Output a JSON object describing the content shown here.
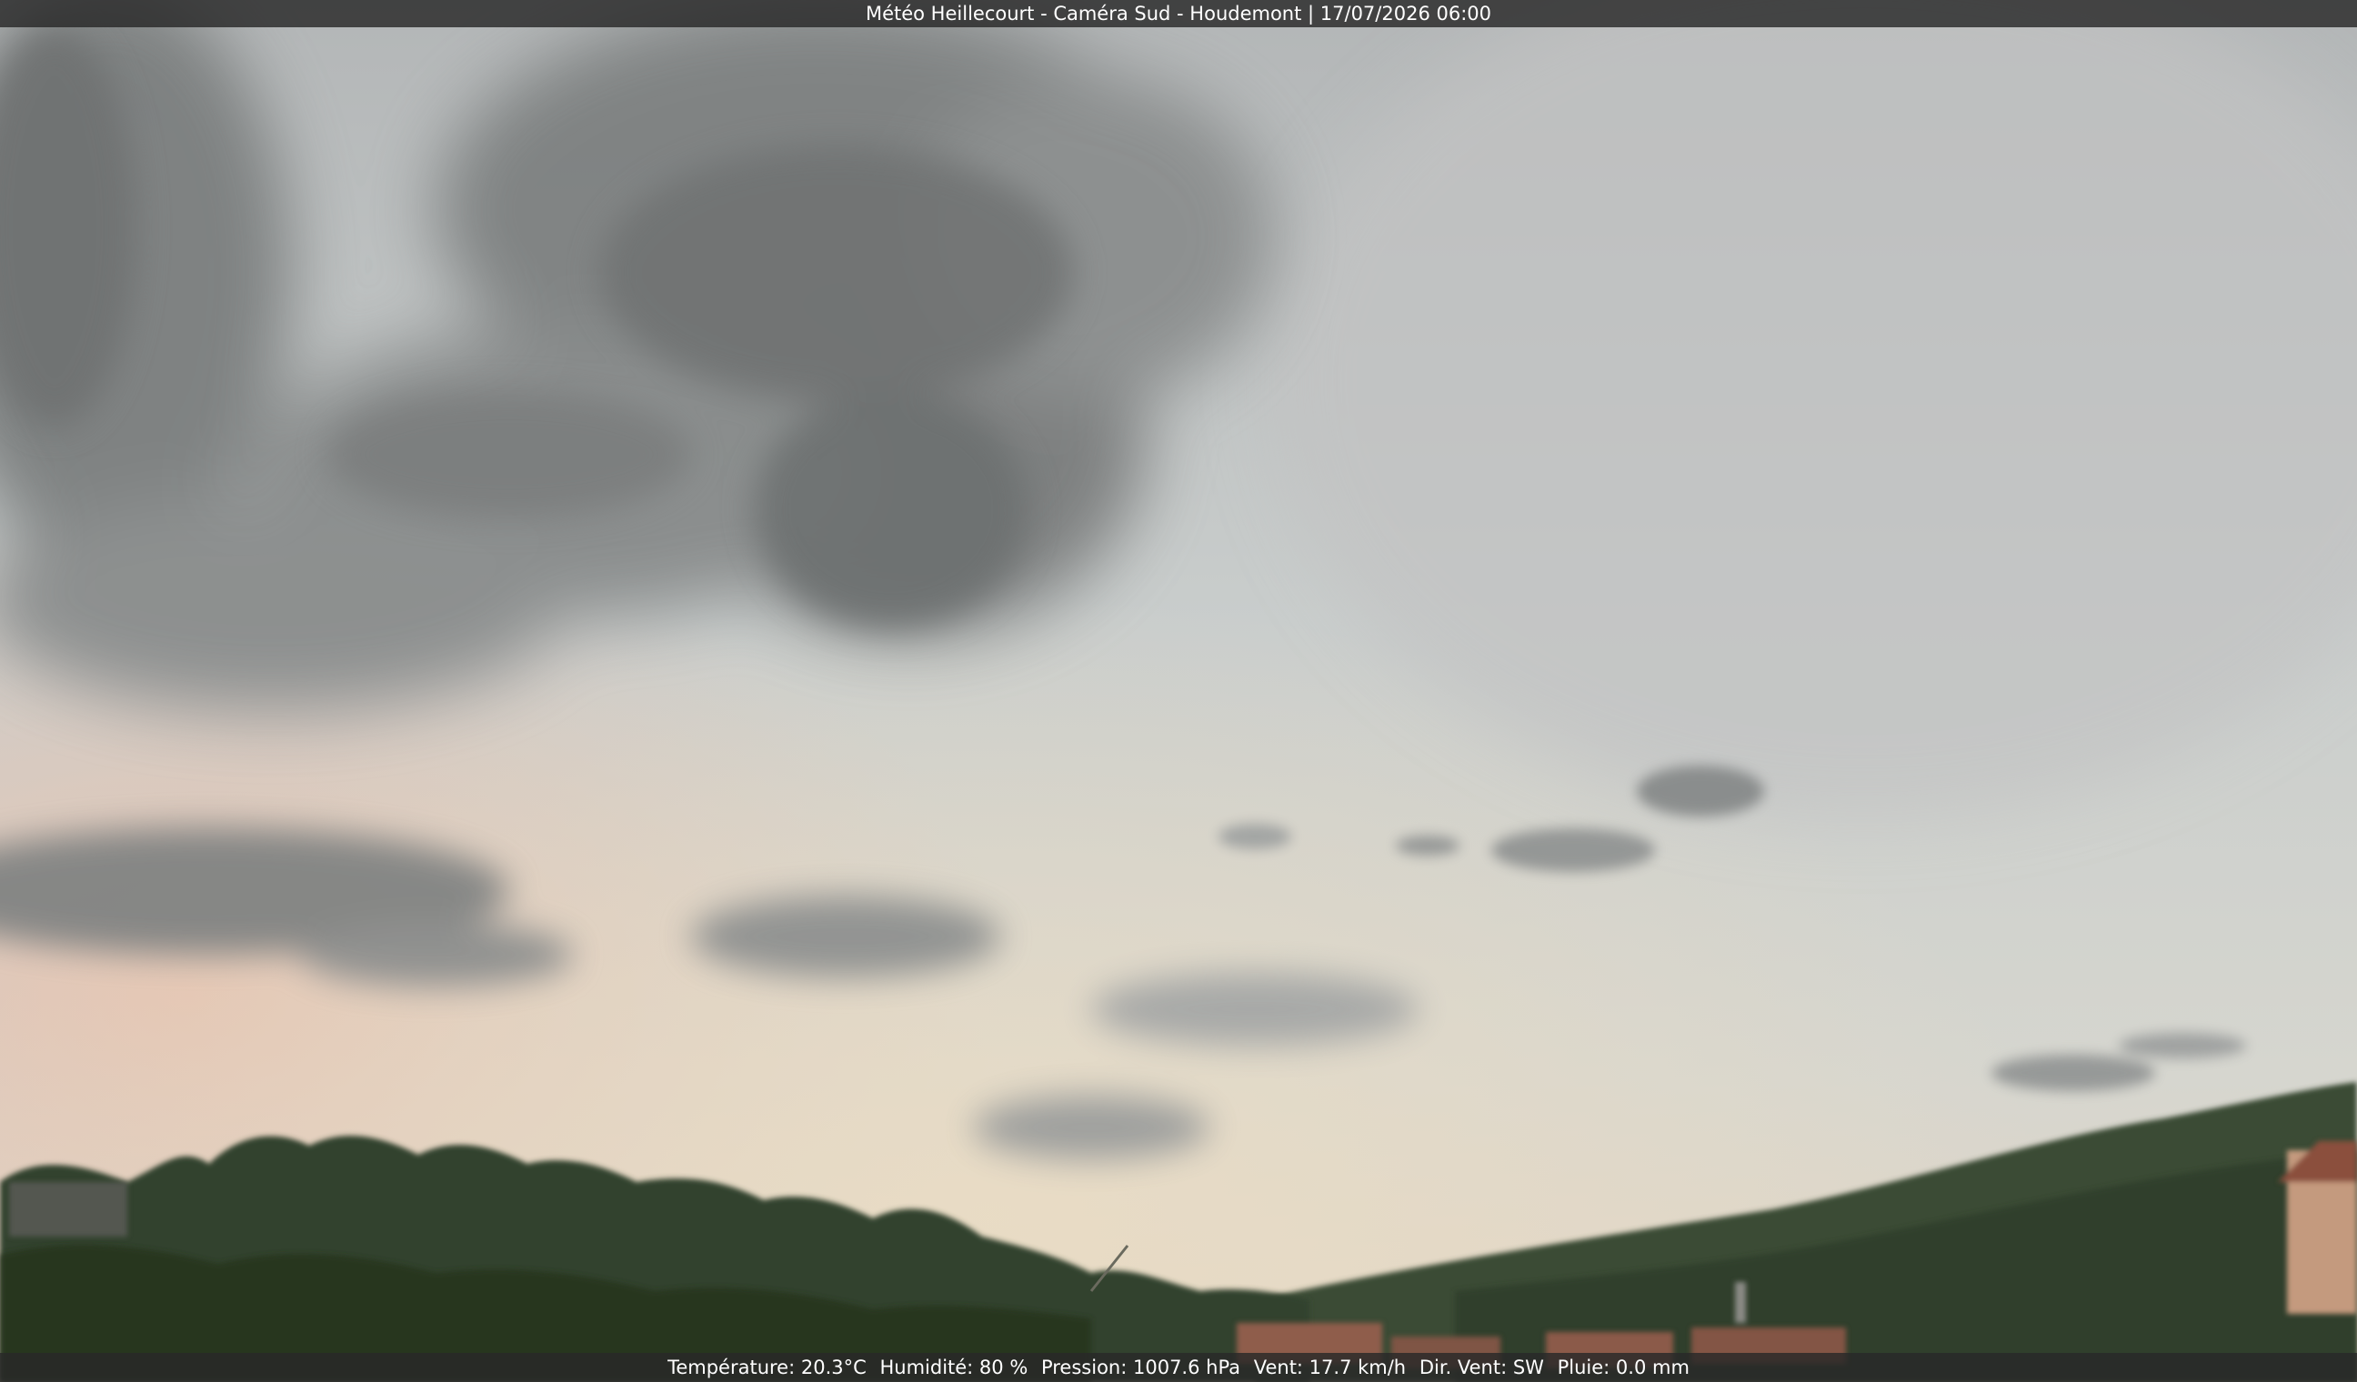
{
  "overlay": {
    "header_text": "Météo Heillecourt - Caméra Sud - Houdemont | 17/07/2026 06:00",
    "temperature": "Température: 20.3°C",
    "humidity": "Humidité: 80 %",
    "pressure": "Pression: 1007.6 hPa",
    "wind_speed": "Vent: 17.7 km/h",
    "wind_direction": "Dir. Vent: SW",
    "rain": "Pluie: 0.0 mm"
  },
  "scene": {
    "subject": "webcam-sky-view",
    "colors": {
      "sky_top": "#b9bcbd",
      "sky_mid": "#cdd1d0",
      "horizon_glow": "#e3d3bf",
      "cloud_dark": "#6e7070",
      "cloud_mid": "#8f9292",
      "treeline": "#2f3f2a",
      "hill": "#3a4d33",
      "roof": "#8b5a4a"
    }
  }
}
